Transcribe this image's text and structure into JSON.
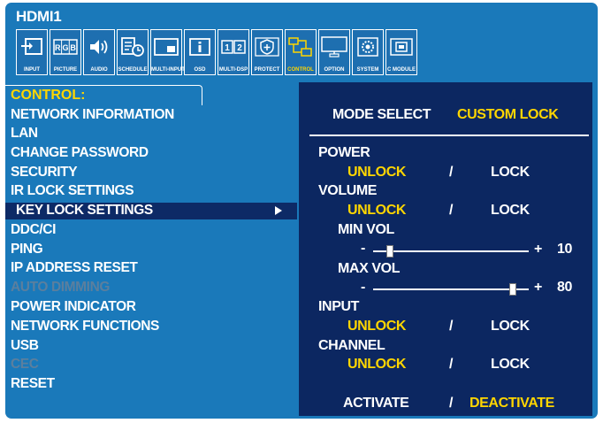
{
  "title": "HDMI1",
  "icons": [
    {
      "label": "INPUT",
      "icon": "input-icon"
    },
    {
      "label": "PICTURE",
      "icon": "picture-icon"
    },
    {
      "label": "AUDIO",
      "icon": "audio-icon"
    },
    {
      "label": "SCHEDULE",
      "icon": "schedule-icon"
    },
    {
      "label": "MULTI-INPUT",
      "icon": "multi-input-icon"
    },
    {
      "label": "OSD",
      "icon": "osd-icon"
    },
    {
      "label": "MULTI-DSP",
      "icon": "multi-dsp-icon"
    },
    {
      "label": "PROTECT",
      "icon": "protect-icon"
    },
    {
      "label": "CONTROL",
      "icon": "control-icon"
    },
    {
      "label": "OPTION",
      "icon": "option-icon"
    },
    {
      "label": "SYSTEM",
      "icon": "system-icon"
    },
    {
      "label": "C MODULE",
      "icon": "c-module-icon"
    }
  ],
  "menu": {
    "title": "CONTROL:",
    "items": [
      {
        "label": "NETWORK INFORMATION",
        "dim": false
      },
      {
        "label": "LAN",
        "dim": false
      },
      {
        "label": "CHANGE PASSWORD",
        "dim": false
      },
      {
        "label": "SECURITY",
        "dim": false
      },
      {
        "label": "IR LOCK SETTINGS",
        "dim": false
      },
      {
        "label": "KEY LOCK SETTINGS",
        "dim": false,
        "selected": true
      },
      {
        "label": "DDC/CI",
        "dim": false
      },
      {
        "label": "PING",
        "dim": false
      },
      {
        "label": "IP ADDRESS RESET",
        "dim": false
      },
      {
        "label": "AUTO DIMMING",
        "dim": true
      },
      {
        "label": "POWER INDICATOR",
        "dim": false
      },
      {
        "label": "NETWORK FUNCTIONS",
        "dim": false
      },
      {
        "label": "USB",
        "dim": false
      },
      {
        "label": "CEC",
        "dim": true
      },
      {
        "label": "RESET",
        "dim": false
      }
    ]
  },
  "panel": {
    "mode_label": "MODE SELECT",
    "mode_value": "CUSTOM LOCK",
    "power": {
      "label": "POWER",
      "unlock": "UNLOCK",
      "sep": "/",
      "lock": "LOCK"
    },
    "volume": {
      "label": "VOLUME",
      "unlock": "UNLOCK",
      "sep": "/",
      "lock": "LOCK"
    },
    "min_vol": {
      "label": "MIN VOL",
      "minus": "-",
      "plus": "+",
      "value": "10",
      "level": 0.1
    },
    "max_vol": {
      "label": "MAX VOL",
      "minus": "-",
      "plus": "+",
      "value": "80",
      "level": 0.8
    },
    "input": {
      "label": "INPUT",
      "unlock": "UNLOCK",
      "sep": "/",
      "lock": "LOCK"
    },
    "channel": {
      "label": "CHANNEL",
      "unlock": "UNLOCK",
      "sep": "/",
      "lock": "LOCK"
    },
    "activate": "ACTIVATE",
    "act_sep": "/",
    "deactivate": "DEACTIVATE"
  },
  "colors": {
    "osd_bg": "#1a79ba",
    "panel_bg": "#0c2761",
    "highlight": "#ffd600",
    "selection": "#0d2a66"
  }
}
